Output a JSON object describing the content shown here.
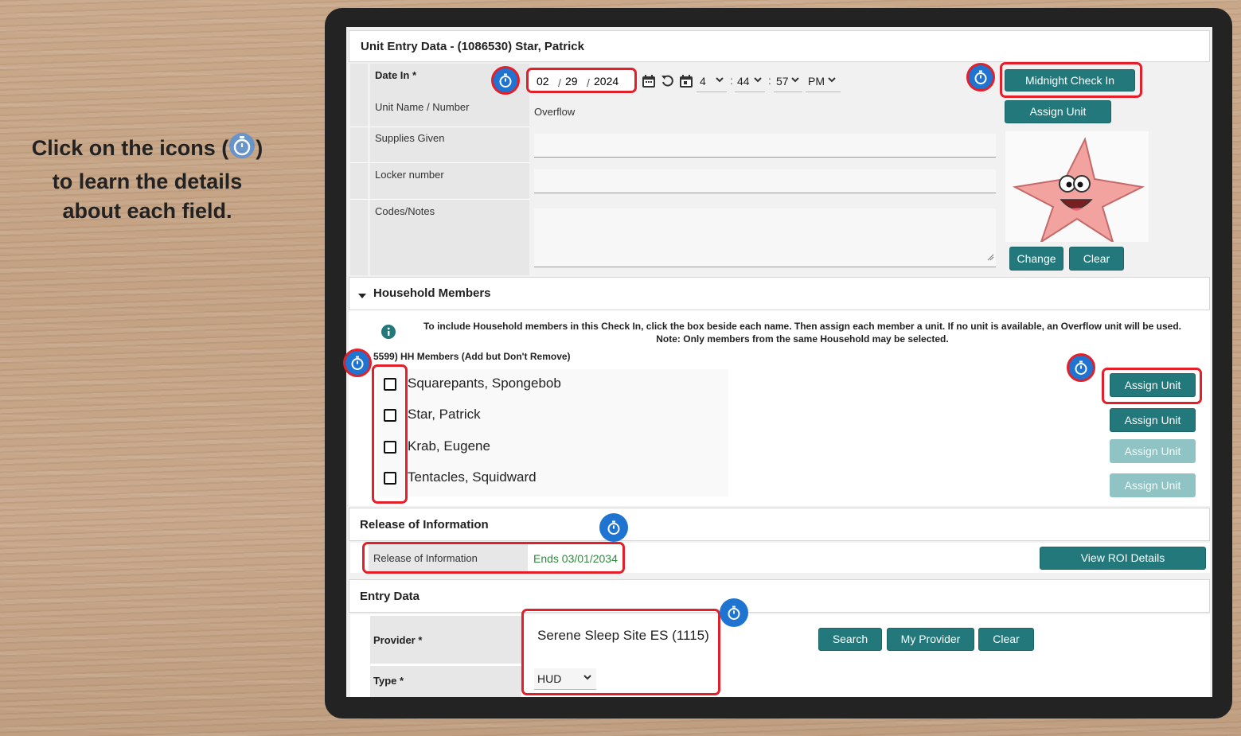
{
  "instruction": {
    "line1_before": "Click on the icons (",
    "line1_after": ")",
    "line2": "to learn the details",
    "line3": "about each field."
  },
  "unit_entry": {
    "title": "Unit Entry Data - (1086530) Star, Patrick",
    "date_in_label": "Date In *",
    "date_month": "02",
    "date_day": "29",
    "date_year": "2024",
    "date_sep": "/",
    "time_hour": "4",
    "time_minute": "44",
    "time_second": "57",
    "time_ampm": "PM",
    "time_sep": ":",
    "midnight_btn": "Midnight Check In",
    "assign_unit_btn": "Assign Unit",
    "unit_name_label": "Unit Name / Number",
    "unit_name_value": "Overflow",
    "supplies_label": "Supplies Given",
    "locker_label": "Locker number",
    "codes_label": "Codes/Notes",
    "change_btn": "Change",
    "clear_btn": "Clear"
  },
  "household": {
    "title": "Household Members",
    "info_text": "To include Household members in this Check In, click the box beside each name. Then assign each member a unit. If no unit is available, an Overflow unit will be used. Note: Only members from the same Household may be selected.",
    "group_label": "5599) HH Members (Add but Don't Remove)",
    "members": [
      {
        "name": "Squarepants, Spongebob",
        "button": "Assign Unit",
        "enabled": true
      },
      {
        "name": "Star, Patrick",
        "button": "Assign Unit",
        "enabled": true
      },
      {
        "name": "Krab, Eugene",
        "button": "Assign Unit",
        "enabled": false
      },
      {
        "name": "Tentacles, Squidward",
        "button": "Assign Unit",
        "enabled": false
      }
    ]
  },
  "roi": {
    "title": "Release of Information",
    "label": "Release of Information",
    "value": "Ends 03/01/2034",
    "button": "View ROI Details"
  },
  "entry": {
    "title": "Entry Data",
    "provider_label": "Provider *",
    "provider_value": "Serene Sleep Site ES (1115)",
    "search_btn": "Search",
    "my_provider_btn": "My Provider",
    "clear_btn": "Clear",
    "type_label": "Type *",
    "type_value": "HUD"
  },
  "colors": {
    "accent": "#22787a",
    "highlight": "#e3202a",
    "hotspot": "#1e74d0",
    "roi_green": "#2f8a3e"
  },
  "icons": [
    "stopwatch-icon",
    "calendar-icon",
    "refresh-icon",
    "info-icon",
    "chevron-down-icon",
    "caret-down-icon",
    "resize-handle-icon"
  ]
}
